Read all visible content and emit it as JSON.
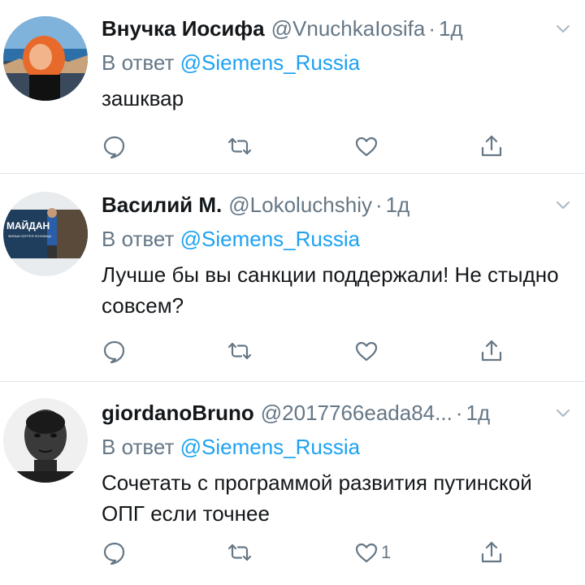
{
  "tweets": [
    {
      "name": "Внучка Иосифа",
      "handle": "@VnuchkaIosifa",
      "date": "1д",
      "reply_prefix": "В ответ",
      "mention": "@Siemens_Russia",
      "text": "зашквар",
      "like_count": ""
    },
    {
      "name": "Василий М.",
      "handle": "@Lokoluchshiy",
      "date": "1д",
      "reply_prefix": "В ответ",
      "mention": "@Siemens_Russia",
      "text": "Лучше бы вы санкции поддержали! Не стыдно совсем?",
      "like_count": "",
      "avatar_text": "МАЙДАН",
      "avatar_subtext": "ФИЛЬМ СЕРГЕЯ ЛОЗНИЦЫ"
    },
    {
      "name": "giordanoBruno",
      "handle": "@2017766eada84...",
      "date": "1д",
      "reply_prefix": "В ответ",
      "mention": "@Siemens_Russia",
      "text": "Сочетать с программой развития путинской ОПГ если точнее",
      "like_count": "1"
    }
  ],
  "colors": {
    "link": "#1da1f2",
    "muted": "#657786",
    "text": "#14171a",
    "divider": "#e1e8ed"
  },
  "icons": [
    "reply-icon",
    "retweet-icon",
    "like-icon",
    "share-icon",
    "chevron-down-icon"
  ]
}
